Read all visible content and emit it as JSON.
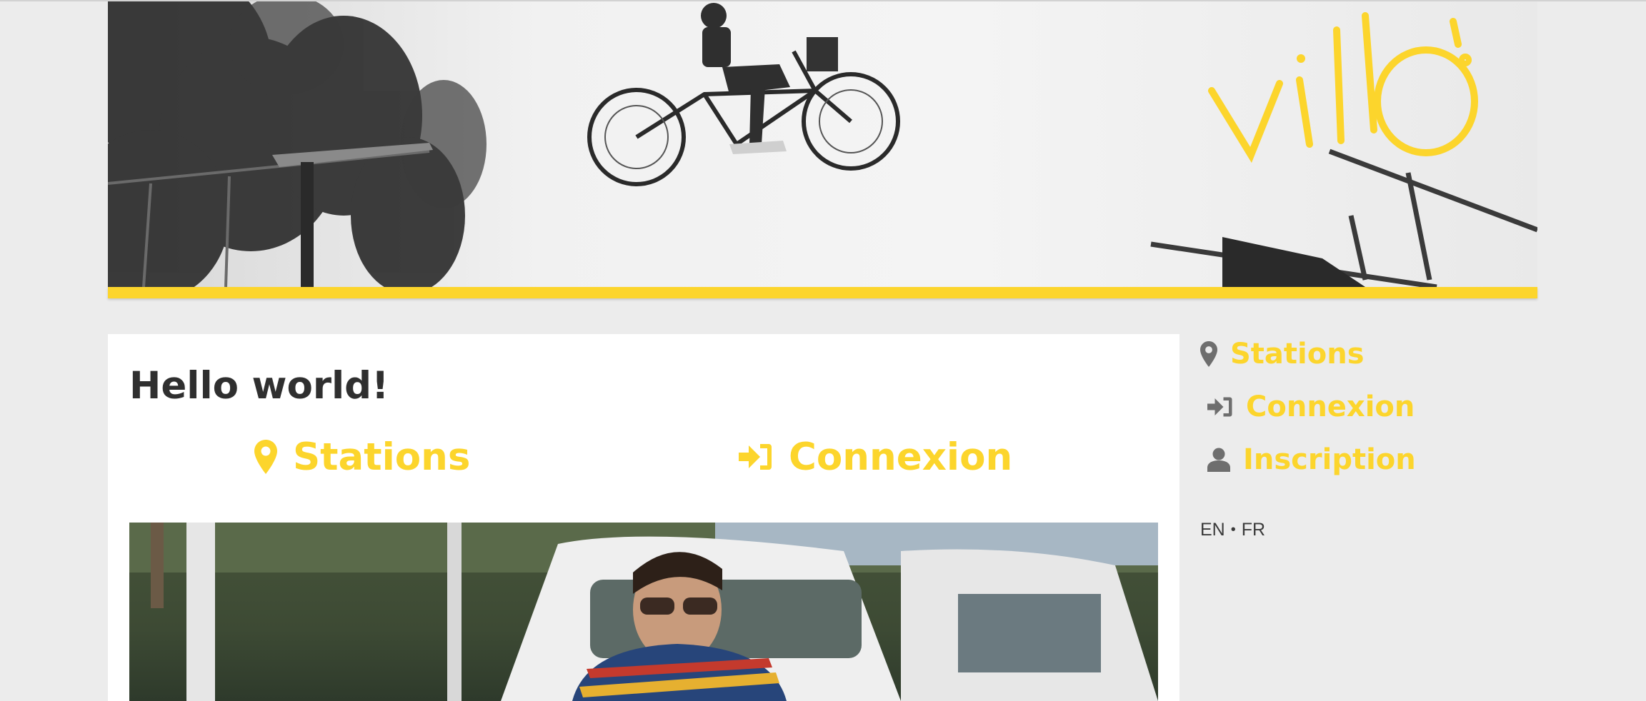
{
  "brand": {
    "logo_text": "villo!",
    "accent_color": "#fcd52c"
  },
  "main": {
    "title": "Hello world!",
    "links": [
      {
        "label": "Stations",
        "icon": "map-marker-icon"
      },
      {
        "label": "Connexion",
        "icon": "sign-in-icon"
      }
    ]
  },
  "sidebar": {
    "items": [
      {
        "label": "Stations",
        "icon": "map-marker-icon"
      },
      {
        "label": "Connexion",
        "icon": "sign-in-icon"
      },
      {
        "label": "Inscription",
        "icon": "user-icon"
      }
    ],
    "languages": {
      "en": "EN",
      "separator": "•",
      "fr": "FR"
    }
  }
}
